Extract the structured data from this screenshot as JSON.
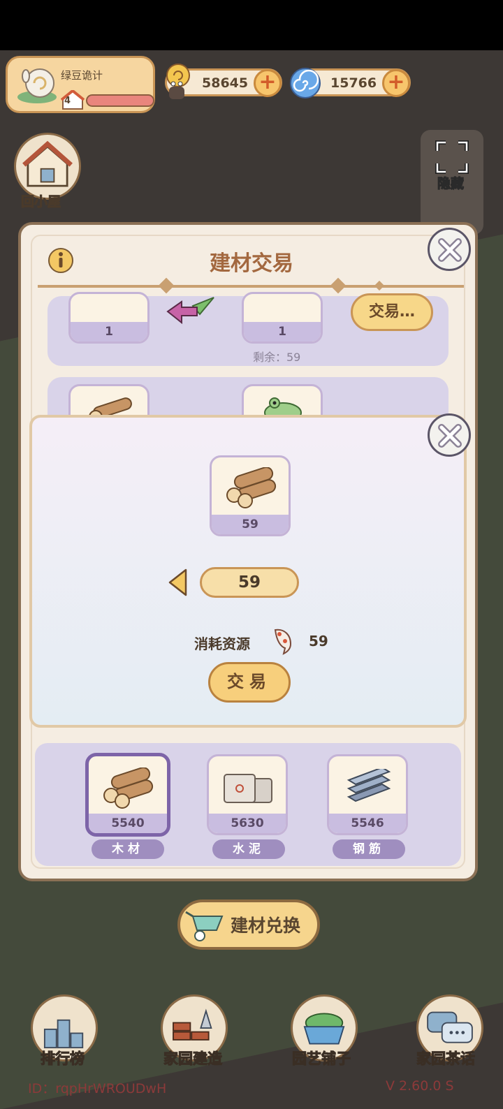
{
  "hud": {
    "player_name": "绿豆诡计",
    "level": "4",
    "coins": "58645",
    "gems": "15766"
  },
  "side": {
    "home_label": "回小屋",
    "hide_label": "隐藏"
  },
  "trade_panel": {
    "title": "建材交易",
    "row1": {
      "give_count": "1",
      "get_count": "1",
      "trade_label": "交易…",
      "remaining": "剩余：59"
    }
  },
  "dialog": {
    "item_count": "59",
    "quantity": "59",
    "cost_label": "消耗资源",
    "cost_value": "59",
    "confirm_label": "交易"
  },
  "materials": [
    {
      "name": "木材",
      "count": "5540",
      "icon": "wood-icon",
      "selected": true
    },
    {
      "name": "水泥",
      "count": "5630",
      "icon": "cement-icon",
      "selected": false
    },
    {
      "name": "钢筋",
      "count": "5546",
      "icon": "rebar-icon",
      "selected": false
    }
  ],
  "exchange_label": "建材兑换",
  "nav": {
    "ranking": "排行榜",
    "build": "家园建造",
    "garden_shop": "园艺铺子",
    "tea_talk": "家园茶话"
  },
  "footer": {
    "id_text": "ID：rqpHrWROUDwH",
    "version": "V 2.60.0 S"
  },
  "colors": {
    "accent": "#c99556",
    "panel_purple": "#d9d3e9",
    "badge_purple": "#9f8ebf"
  }
}
